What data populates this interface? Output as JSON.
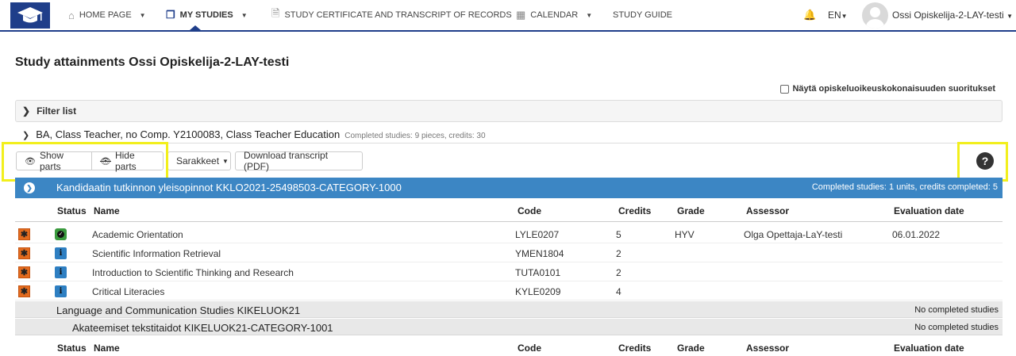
{
  "nav": {
    "home": "HOME PAGE",
    "my_studies": "MY STUDIES",
    "certificate": "STUDY CERTIFICATE AND TRANSCRIPT OF RECORDS",
    "calendar": "CALENDAR",
    "study_guide": "STUDY GUIDE",
    "language": "EN",
    "user": "Ossi Opiskelija-2-LAY-testi"
  },
  "page": {
    "title": "Study attainments Ossi Opiskelija-2-LAY-testi",
    "checkbox_label": "Näytä opiskeluoikeuskokonaisuuden suoritukset",
    "filter_label": "Filter list"
  },
  "degree": {
    "title": "BA, Class Teacher, no Comp. Y2100083, Class Teacher Education",
    "summary": "Completed studies: 9 pieces, credits: 30"
  },
  "toolbar": {
    "show_parts": "Show parts",
    "hide_parts": "Hide parts",
    "columns": "Sarakkeet",
    "download": "Download transcript (PDF)",
    "help": "?"
  },
  "category": {
    "title": "Kandidaatin tutkinnon yleisopinnot KKLO2021-25498503-CATEGORY-1000",
    "summary": "Completed studies: 1 units, credits completed: 5"
  },
  "columns": {
    "status": "Status",
    "name": "Name",
    "code": "Code",
    "credits": "Credits",
    "grade": "Grade",
    "assessor": "Assessor",
    "evaluation_date": "Evaluation date"
  },
  "rows": [
    {
      "name": "Academic Orientation",
      "code": "LYLE0207",
      "credits": "5",
      "grade": "HYV",
      "assessor": "Olga Opettaja-LaY-testi",
      "date": "06.01.2022"
    },
    {
      "name": "Scientific Information Retrieval",
      "code": "YMEN1804",
      "credits": "2",
      "grade": "",
      "assessor": "",
      "date": ""
    },
    {
      "name": "Introduction to Scientific Thinking and Research",
      "code": "TUTA0101",
      "credits": "2",
      "grade": "",
      "assessor": "",
      "date": ""
    },
    {
      "name": "Critical Literacies",
      "code": "KYLE0209",
      "credits": "4",
      "grade": "",
      "assessor": "",
      "date": ""
    }
  ],
  "subcats": [
    {
      "title": "Language and Communication Studies KIKELUOK21",
      "status": "No completed studies"
    },
    {
      "title": "Akateemiset tekstitaidot KIKELUOK21-CATEGORY-1001",
      "status": "No completed studies"
    }
  ]
}
